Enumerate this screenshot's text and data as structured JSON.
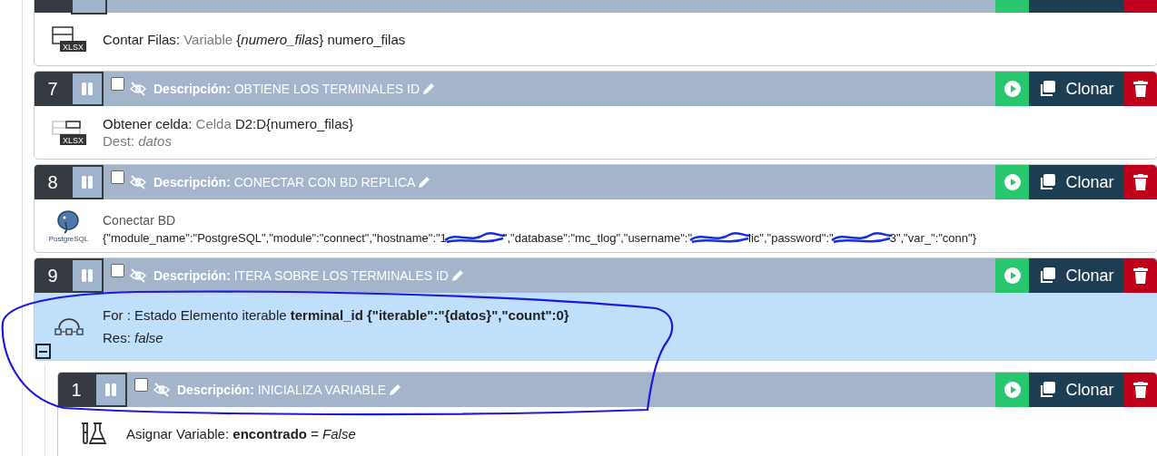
{
  "steps": [
    {
      "kind": "count_rows",
      "selected": false,
      "icon_label": "XLSX",
      "lines": [
        [
          {
            "muted": false,
            "text": "Contar Filas:"
          },
          {
            "muted": true,
            "text": " Variable "
          },
          {
            "muted": false,
            "text": "{*numero_filas*} numero_filas"
          }
        ]
      ]
    },
    {
      "kind": "get_cell",
      "number": "7",
      "checked": false,
      "description_label": "Descripción:",
      "description": "OBTIENE LOS TERMINALES ID",
      "clone": "Clonar",
      "selected": false,
      "icon_label": "XLSX",
      "lines": [
        [
          {
            "muted": false,
            "text": "Obtener celda:"
          },
          {
            "muted": true,
            "text": " Celda "
          },
          {
            "muted": false,
            "text": "D2:D{numero_filas}"
          }
        ],
        [
          {
            "muted": true,
            "text": "Dest: *datos*"
          }
        ]
      ]
    },
    {
      "kind": "connect",
      "number": "8",
      "checked": false,
      "description_label": "Descripción:",
      "description": "CONECTAR CON BD REPLICA",
      "clone": "Clonar",
      "selected": false,
      "icon_label": "PostgreSQL",
      "title": "Conectar BD",
      "params": [
        {
          "kind": "text",
          "text": "{\"module_name\":\"PostgreSQL\",\"module\":\"connect\",\"hostname\":\"1"
        },
        {
          "kind": "redaction"
        },
        {
          "kind": "text",
          "text": "\",\"database\":\"mc_tlog\",\"username\":\""
        },
        {
          "kind": "redaction"
        },
        {
          "kind": "text",
          "text": "lic\",\"password\":\""
        },
        {
          "kind": "redaction"
        },
        {
          "kind": "text",
          "text": "3\",\"var_\":\"conn\"}"
        }
      ]
    },
    {
      "kind": "for",
      "number": "9",
      "checked": false,
      "description_label": "Descripción:",
      "description": "ITERA SOBRE LOS TERMINALES ID",
      "clone": "Clonar",
      "selected": true,
      "expanded": true,
      "lines": [
        [
          {
            "muted": false,
            "text": "For : Estado Elemento iterable **terminal_id {\"iterable\":\"{datos}\",\"count\":0}**"
          }
        ],
        [
          {
            "muted": false,
            "text": "Res: *false*"
          }
        ]
      ],
      "children": [
        {
          "kind": "assign",
          "number": "1",
          "checked": false,
          "description_label": "Descripción:",
          "description": "INICIALIZA VARIABLE",
          "clone": "Clonar",
          "selected": false,
          "lines": [
            [
              {
                "muted": false,
                "text": "Asignar Variable: **encontrado** = *False*"
              }
            ]
          ]
        }
      ]
    }
  ]
}
